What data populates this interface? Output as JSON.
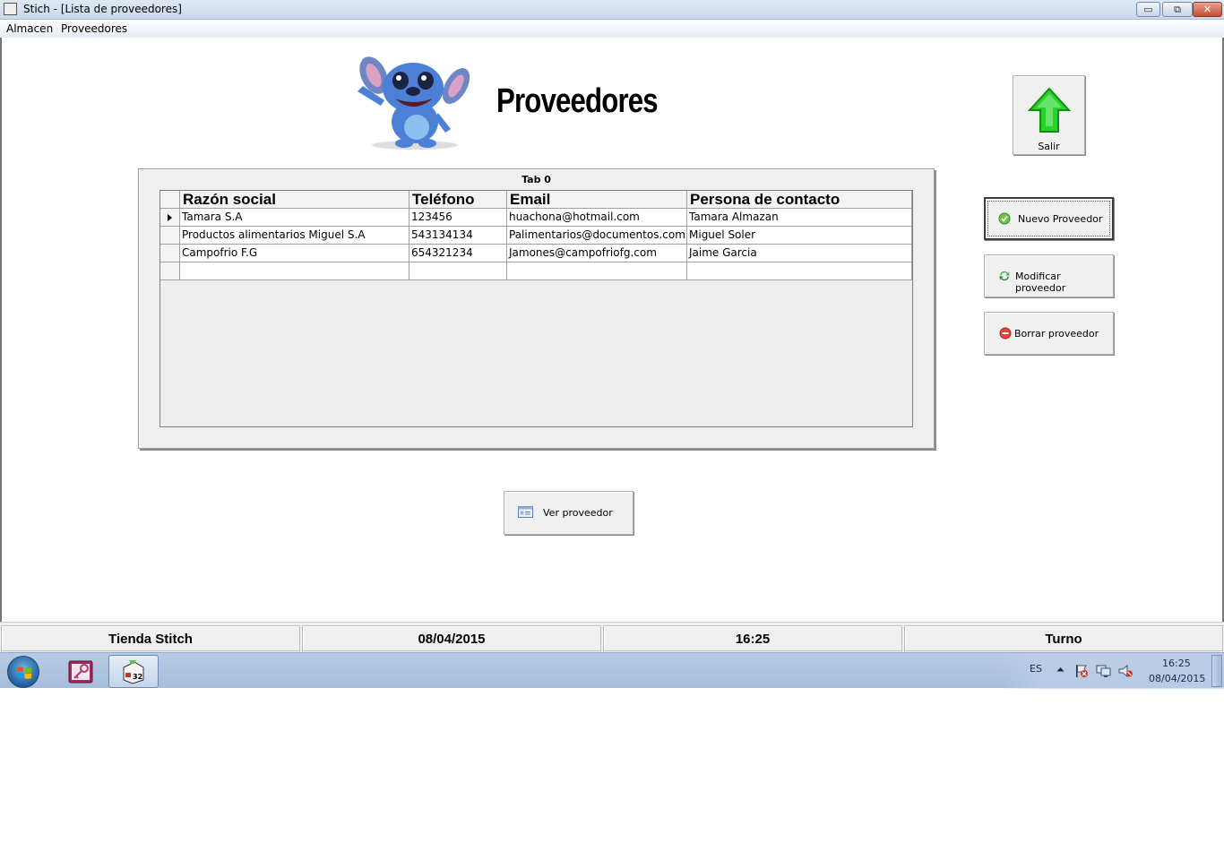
{
  "window": {
    "title": "Stich - [Lista de proveedores]",
    "controls": {
      "minimize": "▭",
      "maximize": "⧉",
      "close": "✕"
    }
  },
  "menubar": {
    "items": [
      "Almacen",
      "Proveedores"
    ]
  },
  "header": {
    "title": "Proveedores"
  },
  "buttons": {
    "salir": "Salir",
    "nuevo": "Nuevo Proveedor",
    "modificar": "Modificar proveedor",
    "borrar": "Borrar proveedor",
    "ver": "Ver proveedor"
  },
  "tab": {
    "label": "Tab 0"
  },
  "table": {
    "columns": [
      "Razón social",
      "Teléfono",
      "Email",
      "Persona de contacto"
    ],
    "rows": [
      [
        "Tamara S.A",
        "123456",
        "huachona@hotmail.com",
        "Tamara Almazan"
      ],
      [
        "Productos alimentarios Miguel S.A",
        "543134134",
        "Palimentarios@documentos.com",
        "Miguel Soler"
      ],
      [
        "Campofrio F.G",
        "654321234",
        "Jamones@campofriofg.com",
        "Jaime Garcia"
      ],
      [
        "",
        "",
        "",
        ""
      ]
    ],
    "selected_row": 0
  },
  "statusbar": {
    "panels": [
      "Tienda Stitch",
      "08/04/2015",
      "16:25",
      "Turno"
    ]
  },
  "taskbar": {
    "language": "ES",
    "clock_time": "16:25",
    "clock_date": "08/04/2015",
    "app_badge": "32"
  },
  "colors": {
    "arrow_green": "#2bd12b",
    "taskbar": "#a6bddb",
    "titlebar": "#c9d8ea"
  },
  "icons": [
    "app-icon",
    "stitch-image",
    "up-arrow-icon",
    "check-icon",
    "refresh-icon",
    "delete-icon",
    "view-card-icon",
    "windows-start-icon",
    "key-app-icon",
    "database-app-icon",
    "tray-arrow-icon",
    "flag-icon",
    "network-icon",
    "volume-muted-icon"
  ]
}
